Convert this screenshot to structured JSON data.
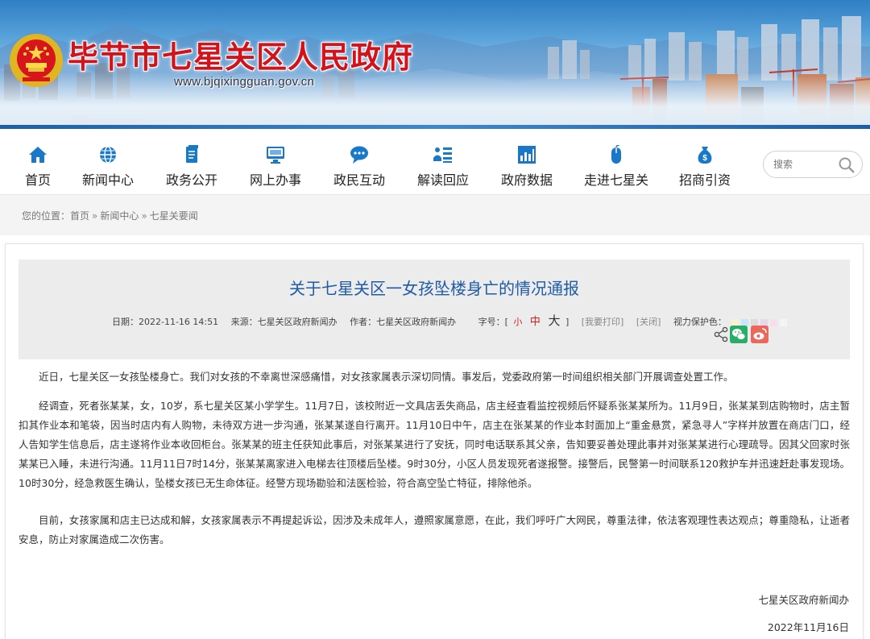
{
  "site": {
    "title": "毕节市七星关区人民政府",
    "url": "www.bjqixingguan.gov.cn"
  },
  "nav": {
    "items": [
      {
        "label": "首页",
        "icon": "home-icon"
      },
      {
        "label": "新闻中心",
        "icon": "globe-icon"
      },
      {
        "label": "政务公开",
        "icon": "document-icon"
      },
      {
        "label": "网上办事",
        "icon": "monitor-icon"
      },
      {
        "label": "政民互动",
        "icon": "chat-bubble-icon"
      },
      {
        "label": "解读回应",
        "icon": "list-icon"
      },
      {
        "label": "政府数据",
        "icon": "bar-chart-icon"
      },
      {
        "label": "走进七星关",
        "icon": "mouse-icon"
      },
      {
        "label": "招商引资",
        "icon": "money-bag-icon"
      }
    ],
    "search_placeholder": "搜索"
  },
  "breadcrumb": {
    "prefix": "您的位置：",
    "items": [
      "首页",
      "新闻中心",
      "七星关要闻"
    ],
    "separator": "»"
  },
  "article": {
    "title": "关于七星关区一女孩坠楼身亡的情况通报",
    "meta": {
      "date": "日期：2022-11-16 14:51",
      "source": "来源：七星关区政府新闻办",
      "author": "作者：七星关区政府新闻办",
      "font_size_label": "字号：[",
      "font_small": "小",
      "font_mid": "中",
      "font_big": "大",
      "font_close": "]",
      "print": "[我要打印]",
      "close": "[关闭]",
      "vision_label": "视力保护色：",
      "vision_colors": [
        "#faf0d2",
        "#c8e6fa",
        "#dcdcdc",
        "#e8d8ec",
        "#f6dfe8",
        "#f4f4f4"
      ]
    },
    "share": {
      "icons": [
        "share-icon",
        "wechat-icon",
        "weibo-icon"
      ]
    },
    "paragraphs": [
      "近日，七星关区一女孩坠楼身亡。我们对女孩的不幸离世深感痛惜，对女孩家属表示深切同情。事发后，党委政府第一时间组织相关部门开展调查处置工作。",
      "经调查，死者张某某，女，10岁，系七星关区某小学学生。11月7日，该校附近一文具店丢失商品，店主经查看监控视频后怀疑系张某某所为。11月9日，张某某到店购物时，店主暂扣其作业本和笔袋，因当时店内有人购物，未待双方进一步沟通，张某某遂自行离开。11月10日中午，店主在张某某的作业本封面加上“重金悬赏，紧急寻人”字样并放置在商店门口，经人告知学生信息后，店主遂将作业本收回柜台。张某某的班主任获知此事后，对张某某进行了安抚，同时电话联系其父亲，告知要妥善处理此事并对张某某进行心理疏导。因其父回家时张某某已入睡，未进行沟通。11月11日7时14分，张某某离家进入电梯去往顶楼后坠楼。9时30分，小区人员发现死者遂报警。接警后，民警第一时间联系120救护车并迅速赶赴事发现场。10时30分，经急救医生确认，坠楼女孩已无生命体征。经警方现场勘验和法医检验，符合高空坠亡特征，排除他杀。",
      "目前，女孩家属和店主已达成和解，女孩家属表示不再提起诉讼，因涉及未成年人，遵照家属意愿，在此，我们呼吁广大网民，尊重法律，依法客观理性表达观点；尊重隐私，让逝者安息，防止对家属造成二次伤害。"
    ],
    "signature": "七星关区政府新闻办",
    "sign_date": "2022年11月16日"
  },
  "colors": {
    "title_red": "#d3131b",
    "article_title_blue": "#1f5ba6",
    "nav_icon_blue": "#1a78c9",
    "wechat_green": "#2aae67",
    "weibo_red": "#e9675b"
  }
}
